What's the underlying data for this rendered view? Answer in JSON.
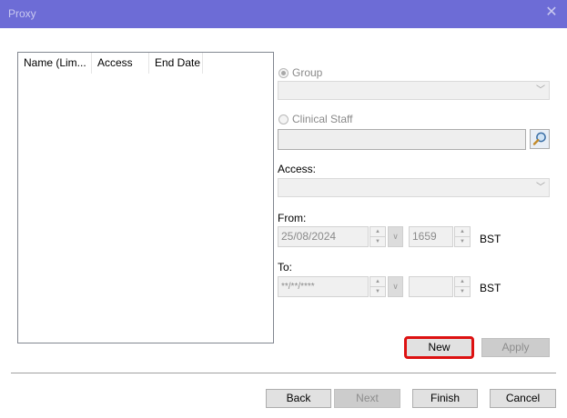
{
  "window": {
    "title": "Proxy",
    "close_icon": "close-icon"
  },
  "list": {
    "columns": [
      "Name (Lim...",
      "Access",
      "End Date"
    ],
    "rows": []
  },
  "group": {
    "label": "Group",
    "selected": true,
    "value": ""
  },
  "clinical_staff": {
    "label": "Clinical Staff",
    "selected": false,
    "value": "",
    "search_icon": "search-icon"
  },
  "access": {
    "label": "Access:",
    "value": ""
  },
  "from": {
    "label": "From:",
    "date": "25/08/2024",
    "time": "1659",
    "timezone": "BST"
  },
  "to": {
    "label": "To:",
    "date": "**/**/****",
    "time": "",
    "timezone": "BST"
  },
  "buttons": {
    "new": "New",
    "apply": "Apply",
    "back": "Back",
    "next": "Next",
    "finish": "Finish",
    "cancel": "Cancel"
  }
}
